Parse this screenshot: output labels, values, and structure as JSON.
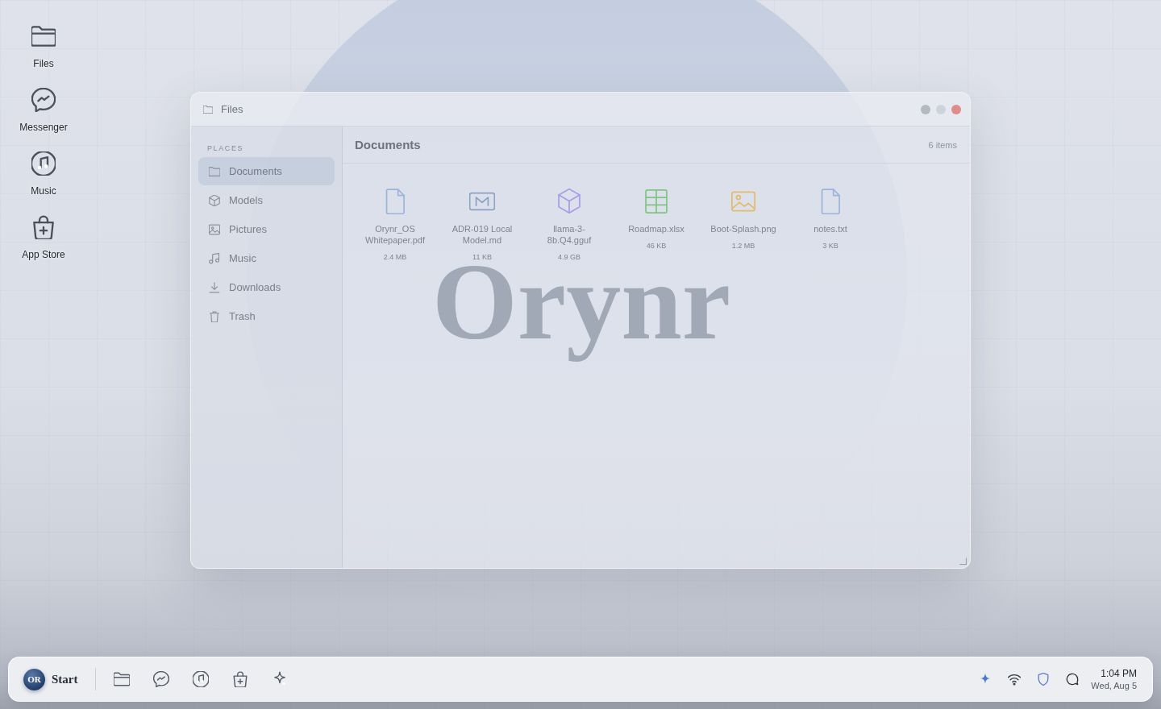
{
  "desktop_icons": [
    {
      "label": "Files",
      "kind": "folder"
    },
    {
      "label": "Messenger",
      "kind": "messenger"
    },
    {
      "label": "Music",
      "kind": "music"
    },
    {
      "label": "App Store",
      "kind": "store"
    }
  ],
  "brand_text": "Orynr",
  "window": {
    "title": "Files",
    "controls": [
      {
        "kind": "minimize"
      },
      {
        "kind": "maximize"
      },
      {
        "kind": "close"
      }
    ],
    "sidebar": {
      "heading": "PLACES",
      "items": [
        {
          "label": "Documents",
          "kind": "folder",
          "selected": true
        },
        {
          "label": "Models",
          "kind": "cube",
          "selected": false
        },
        {
          "label": "Pictures",
          "kind": "picture",
          "selected": false
        },
        {
          "label": "Music",
          "kind": "music",
          "selected": false
        },
        {
          "label": "Downloads",
          "kind": "download",
          "selected": false
        },
        {
          "label": "Trash",
          "kind": "trash",
          "selected": false
        }
      ]
    },
    "main": {
      "title": "Documents",
      "count": "6 items",
      "files": [
        {
          "name": "Orynr_OS Whitepaper.pdf",
          "size": "2.4 MB",
          "kind": "document"
        },
        {
          "name": "ADR-019 Local Model.md",
          "size": "11 KB",
          "kind": "markdown"
        },
        {
          "name": "llama-3-8b.Q4.gguf",
          "size": "4.9 GB",
          "kind": "model"
        },
        {
          "name": "Roadmap.xlsx",
          "size": "46 KB",
          "kind": "spreadsheet"
        },
        {
          "name": "Boot-Splash.png",
          "size": "1.2 MB",
          "kind": "image"
        },
        {
          "name": "notes.txt",
          "size": "3 KB",
          "kind": "document"
        }
      ]
    }
  },
  "taskbar": {
    "start": {
      "badge": "OR",
      "label": "Start"
    },
    "apps": [
      {
        "kind": "folder"
      },
      {
        "kind": "messenger"
      },
      {
        "kind": "music"
      },
      {
        "kind": "store"
      },
      {
        "kind": "sparkle"
      }
    ],
    "tray": [
      {
        "kind": "sparkle"
      },
      {
        "kind": "wifi"
      },
      {
        "kind": "shield"
      },
      {
        "kind": "chat"
      }
    ],
    "clock": {
      "time": "1:04 PM",
      "date": "Wed, Aug 5"
    }
  }
}
